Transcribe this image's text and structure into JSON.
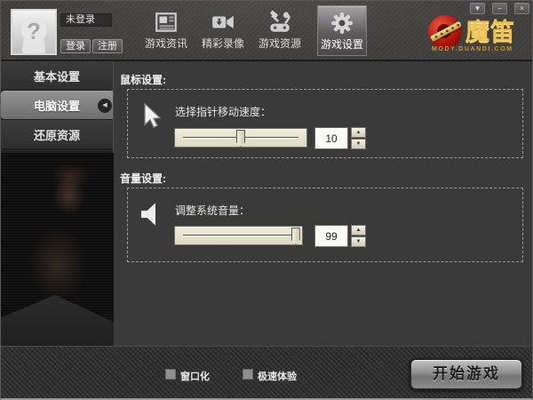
{
  "window_controls": [
    {
      "name": "dropdown",
      "glyph": "▼"
    },
    {
      "name": "minimize",
      "glyph": "−"
    },
    {
      "name": "close",
      "glyph": "×"
    }
  ],
  "header": {
    "user": {
      "status": "未登录",
      "avatar_glyph": "?",
      "login_label": "登录",
      "register_label": "注册"
    },
    "toolbar": [
      {
        "label": "游戏资讯",
        "icon": "news-icon",
        "selected": false
      },
      {
        "label": "精彩录像",
        "icon": "video-icon",
        "selected": false
      },
      {
        "label": "游戏资源",
        "icon": "resources-icon",
        "selected": false
      },
      {
        "label": "游戏设置",
        "icon": "gear-icon",
        "selected": true
      }
    ],
    "logo": {
      "title": "魔笛",
      "subtitle": "MODY.DUANDI.COM"
    }
  },
  "sidebar": {
    "items": [
      {
        "label": "基本设置",
        "selected": false
      },
      {
        "label": "电脑设置",
        "selected": true
      },
      {
        "label": "还原资源",
        "selected": false
      }
    ],
    "selected_arrow_glyph": "◀"
  },
  "main": {
    "mouse": {
      "section_title": "鼠标设置:",
      "icon": "cursor-icon",
      "label": "选择指针移动速度：",
      "value": "10",
      "slider_percent": 50
    },
    "volume": {
      "section_title": "音量设置:",
      "icon": "speaker-icon",
      "label": "调整系统音量：",
      "value": "99",
      "slider_percent": 95
    },
    "spinner": {
      "up_glyph": "▲",
      "down_glyph": "▼"
    }
  },
  "footer": {
    "checkboxes": [
      {
        "label": "窗口化",
        "checked": false
      },
      {
        "label": "极速体验",
        "checked": false
      }
    ],
    "start_button_label": "开始游戏"
  },
  "colors": {
    "logo_red": "#b01408",
    "accent_gold": "#eec253",
    "slider_beige": "#e9e5d2",
    "panel_bg": "#3a3a3a",
    "selected_gray": "#858585"
  }
}
